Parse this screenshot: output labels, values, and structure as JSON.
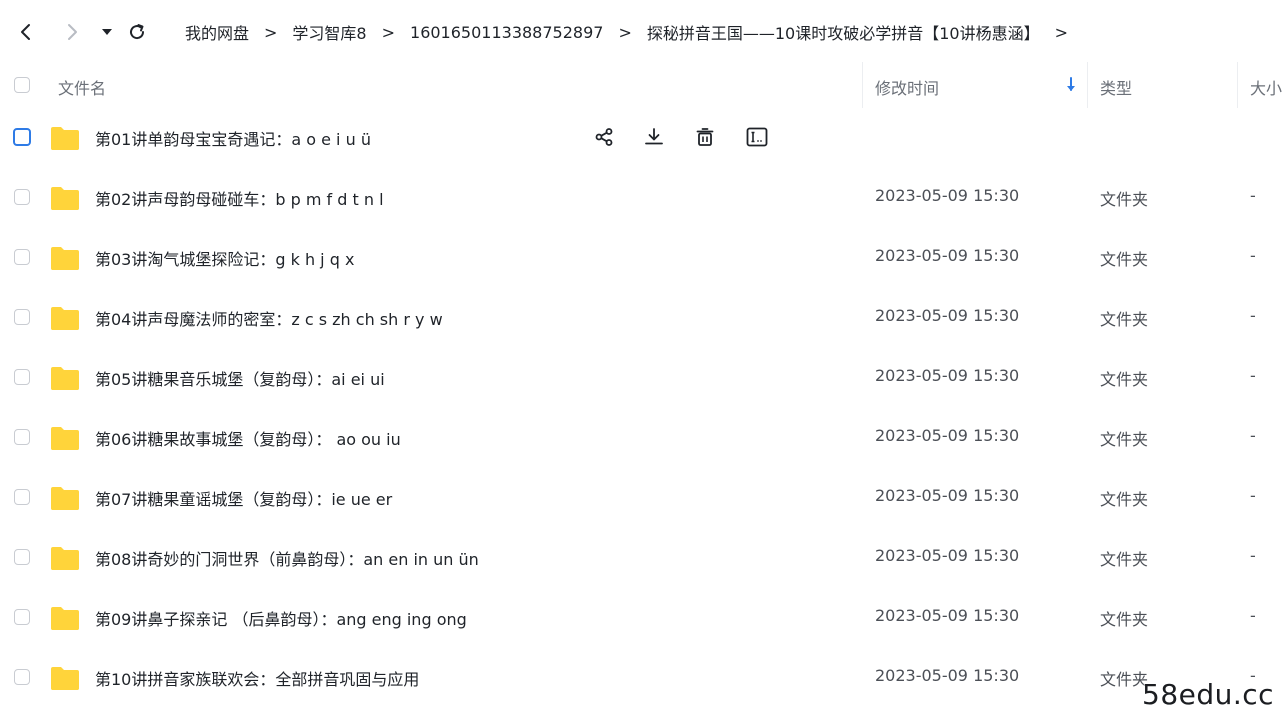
{
  "breadcrumb": [
    "我的网盘",
    "学习智库8",
    "1601650113388752897",
    "探秘拼音王国——10课时攻破必学拼音【10讲杨惠涵】"
  ],
  "breadcrumb_trailing_sep": ">",
  "header": {
    "name": "文件名",
    "modified": "修改时间",
    "type": "类型",
    "size": "大小"
  },
  "colors": {
    "folder": "#ffd43b",
    "accent": "#2e7be6",
    "sort_arrow": "#2e7be6"
  },
  "rows": [
    {
      "name": "第01讲单韵母宝宝奇遇记：a o e i u ü",
      "time": "",
      "type": "",
      "size": "",
      "hovered": true
    },
    {
      "name": "第02讲声母韵母碰碰车：b p m f d t n l",
      "time": "2023-05-09 15:30",
      "type": "文件夹",
      "size": "-"
    },
    {
      "name": "第03讲淘气城堡探险记：g k h j q x",
      "time": "2023-05-09 15:30",
      "type": "文件夹",
      "size": "-"
    },
    {
      "name": "第04讲声母魔法师的密室：z c s zh ch sh r y w",
      "time": "2023-05-09 15:30",
      "type": "文件夹",
      "size": "-"
    },
    {
      "name": "第05讲糖果音乐城堡（复韵母）：ai ei ui",
      "time": "2023-05-09 15:30",
      "type": "文件夹",
      "size": "-"
    },
    {
      "name": "第06讲糖果故事城堡（复韵母）： ao ou iu",
      "time": "2023-05-09 15:30",
      "type": "文件夹",
      "size": "-"
    },
    {
      "name": "第07讲糖果童谣城堡（复韵母）：ie ue er",
      "time": "2023-05-09 15:30",
      "type": "文件夹",
      "size": "-"
    },
    {
      "name": "第08讲奇妙的门洞世界（前鼻韵母）：an en in un ün",
      "time": "2023-05-09 15:30",
      "type": "文件夹",
      "size": "-"
    },
    {
      "name": "第09讲鼻子探亲记 （后鼻韵母）：ang eng ing ong",
      "time": "2023-05-09 15:30",
      "type": "文件夹",
      "size": "-"
    },
    {
      "name": "第10讲拼音家族联欢会：全部拼音巩固与应用",
      "time": "2023-05-09 15:30",
      "type": "文件夹",
      "size": "-"
    }
  ],
  "row_actions": [
    "share-icon",
    "download-icon",
    "delete-icon",
    "rename-icon"
  ],
  "watermark": "58edu.cc"
}
